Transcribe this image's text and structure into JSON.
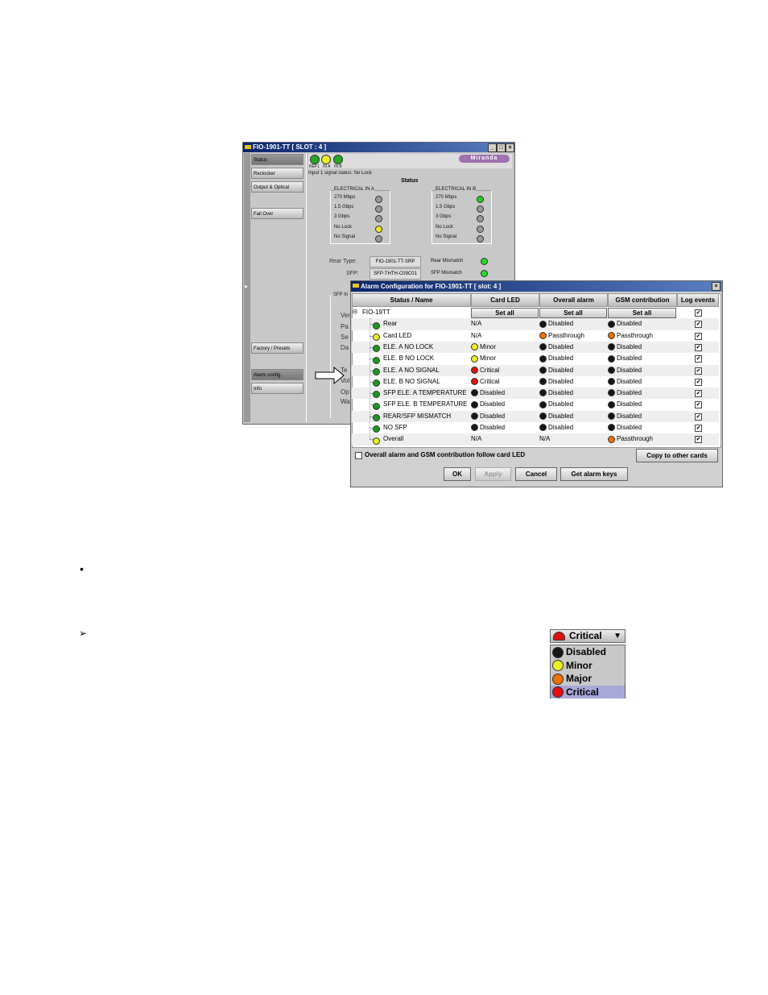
{
  "bg_window": {
    "title": "FIO-1901-TT [ SLOT : 4 ]",
    "logo": "Miranda",
    "nav": [
      "Status",
      "Reclocker",
      "Output & Optical",
      "Fail Over",
      "Factory / Presets",
      "Alarm config.",
      "Info"
    ],
    "icons": [
      "REF1",
      "IN A",
      "IN B"
    ],
    "signal_status": "Input 1 signal status: No Lock",
    "status_title": "Status",
    "group_a": {
      "title": "ELECTRICAL IN A",
      "items": [
        {
          "label": "270 Mbps",
          "color": "#9a9a9a"
        },
        {
          "label": "1.5 Gbps",
          "color": "#9a9a9a"
        },
        {
          "label": "3 Gbps",
          "color": "#9a9a9a"
        },
        {
          "label": "No Lock",
          "color": "#e8e820"
        },
        {
          "label": "No Signal",
          "color": "#9a9a9a"
        }
      ]
    },
    "group_b": {
      "title": "ELECTRICAL IN B",
      "items": [
        {
          "label": "270 Mbps",
          "color": "#20d020"
        },
        {
          "label": "1.5 Gbps",
          "color": "#9a9a9a"
        },
        {
          "label": "3 Gbps",
          "color": "#9a9a9a"
        },
        {
          "label": "No Lock",
          "color": "#9a9a9a"
        },
        {
          "label": "No Signal",
          "color": "#9a9a9a"
        }
      ]
    },
    "rear_type_label": "Rear Type:",
    "rear_type": "FIO-1901-TT-SRP",
    "sfp_label": "SFP:",
    "sfp": "SFP-THTH-C09C01",
    "rear_mismatch": "Rear Mismatch",
    "sfp_mismatch": "SFP Mismatch",
    "sfp_info": "SFP In",
    "partial_labels": [
      "Ver",
      "Pa",
      "Se",
      "Da",
      "Te",
      "Vol",
      "Op",
      "Wa"
    ]
  },
  "dialog": {
    "title": "Alarm Configuration for FIO-1901-TT [ slot: 4 ]",
    "columns": [
      "Status / Name",
      "Card LED",
      "Overall alarm",
      "GSM contribution",
      "Log events"
    ],
    "root": "FIO-19TT",
    "set_all": "Set all",
    "rows": [
      {
        "name": "Rear",
        "status": "green",
        "card": [
          "",
          "N/A"
        ],
        "overall": [
          "black",
          "Disabled"
        ],
        "gsm": [
          "black",
          "Disabled"
        ],
        "log": true
      },
      {
        "name": "Card LED",
        "status": "yellow",
        "card": [
          "",
          "N/A"
        ],
        "overall": [
          "orange",
          "Passthrough"
        ],
        "gsm": [
          "orange",
          "Passthrough"
        ],
        "log": true
      },
      {
        "name": "ELE. A NO LOCK",
        "status": "green",
        "card": [
          "yellow",
          "Minor"
        ],
        "overall": [
          "black",
          "Disabled"
        ],
        "gsm": [
          "black",
          "Disabled"
        ],
        "log": true
      },
      {
        "name": "ELE. B NO LOCK",
        "status": "green",
        "card": [
          "yellow",
          "Minor"
        ],
        "overall": [
          "black",
          "Disabled"
        ],
        "gsm": [
          "black",
          "Disabled"
        ],
        "log": true
      },
      {
        "name": "ELE. A NO SIGNAL",
        "status": "green",
        "card": [
          "red",
          "Critical"
        ],
        "overall": [
          "black",
          "Disabled"
        ],
        "gsm": [
          "black",
          "Disabled"
        ],
        "log": true
      },
      {
        "name": "ELE. B NO SIGNAL",
        "status": "green",
        "card": [
          "red",
          "Critical"
        ],
        "overall": [
          "black",
          "Disabled"
        ],
        "gsm": [
          "black",
          "Disabled"
        ],
        "log": true
      },
      {
        "name": "SFP ELE. A TEMPERATURE",
        "status": "green",
        "card": [
          "black",
          "Disabled"
        ],
        "overall": [
          "black",
          "Disabled"
        ],
        "gsm": [
          "black",
          "Disabled"
        ],
        "log": true
      },
      {
        "name": "SFP ELE. B TEMPERATURE",
        "status": "green",
        "card": [
          "black",
          "Disabled"
        ],
        "overall": [
          "black",
          "Disabled"
        ],
        "gsm": [
          "black",
          "Disabled"
        ],
        "log": true
      },
      {
        "name": "REAR/SFP MISMATCH",
        "status": "green",
        "card": [
          "black",
          "Disabled"
        ],
        "overall": [
          "black",
          "Disabled"
        ],
        "gsm": [
          "black",
          "Disabled"
        ],
        "log": true
      },
      {
        "name": "NO SFP",
        "status": "green",
        "card": [
          "black",
          "Disabled"
        ],
        "overall": [
          "black",
          "Disabled"
        ],
        "gsm": [
          "black",
          "Disabled"
        ],
        "log": true
      },
      {
        "name": "Overall",
        "status": "yellow",
        "card": [
          "",
          "N/A"
        ],
        "overall": [
          "",
          "N/A"
        ],
        "gsm": [
          "orange",
          "Passthrough"
        ],
        "log": true
      }
    ],
    "follow_label": "Overall alarm and GSM contribution follow card LED",
    "follow_checked": false,
    "copy": "Copy to other cards",
    "ok": "OK",
    "apply": "Apply",
    "cancel": "Cancel",
    "get_keys": "Get alarm keys"
  },
  "colors": {
    "green": "#1a9a1a",
    "yellow": "#f0f020",
    "red": "#e01010",
    "orange": "#f07000",
    "black": "#151515"
  },
  "dropdown": {
    "selected": "Critical",
    "options": [
      {
        "label": "Disabled",
        "color": "black"
      },
      {
        "label": "Minor",
        "color": "yellow"
      },
      {
        "label": "Major",
        "color": "orange"
      },
      {
        "label": "Critical",
        "color": "red"
      }
    ],
    "highlighted": "Critical"
  },
  "bullets": {
    "bullet": "•",
    "arrow": "➢"
  }
}
